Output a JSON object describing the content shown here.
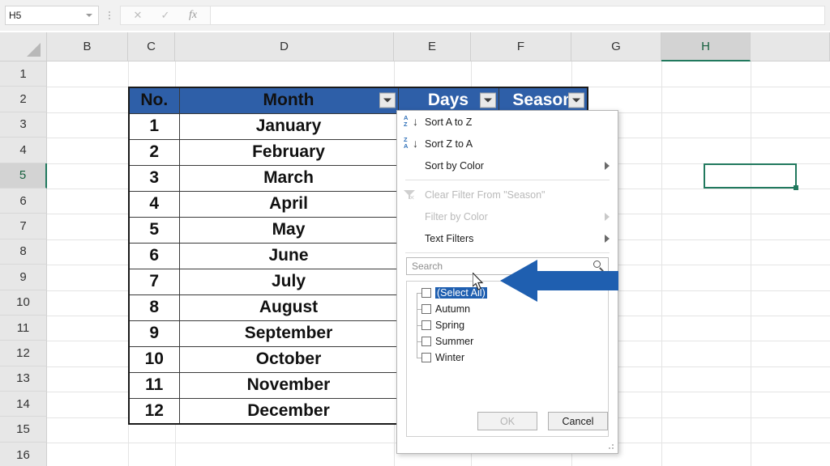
{
  "app": {
    "name_box_value": "H5",
    "formula_bar_value": "",
    "formula_icons": [
      "cancel-x",
      "enter-check",
      "insert-function-fx"
    ]
  },
  "grid": {
    "columns": [
      "B",
      "C",
      "D",
      "E",
      "F",
      "G",
      "H"
    ],
    "selected_column": "H",
    "rows": [
      "1",
      "2",
      "3",
      "4",
      "5",
      "6",
      "7",
      "8",
      "9",
      "10",
      "11",
      "12",
      "13",
      "14",
      "15",
      "16"
    ],
    "selected_row": "5",
    "selected_cell": "H5"
  },
  "table": {
    "headers": [
      "No.",
      "Month",
      "Days",
      "Season"
    ],
    "header_bg": "#2e5fa8",
    "header_color": "#ffffff",
    "rows": [
      {
        "no": "1",
        "month": "January",
        "days": "",
        "season": ""
      },
      {
        "no": "2",
        "month": "February",
        "days": "",
        "season": ""
      },
      {
        "no": "3",
        "month": "March",
        "days": "",
        "season": ""
      },
      {
        "no": "4",
        "month": "April",
        "days": "",
        "season": ""
      },
      {
        "no": "5",
        "month": "May",
        "days": "",
        "season": ""
      },
      {
        "no": "6",
        "month": "June",
        "days": "",
        "season": ""
      },
      {
        "no": "7",
        "month": "July",
        "days": "",
        "season": ""
      },
      {
        "no": "8",
        "month": "August",
        "days": "",
        "season": ""
      },
      {
        "no": "9",
        "month": "September",
        "days": "",
        "season": ""
      },
      {
        "no": "10",
        "month": "October",
        "days": "",
        "season": ""
      },
      {
        "no": "11",
        "month": "November",
        "days": "",
        "season": ""
      },
      {
        "no": "12",
        "month": "December",
        "days": "",
        "season": ""
      }
    ]
  },
  "filter_menu": {
    "sort_a_to_z": "Sort A to Z",
    "sort_z_to_a": "Sort Z to A",
    "sort_by_color": "Sort by Color",
    "clear_filter": "Clear Filter From \"Season\"",
    "filter_by_color": "Filter by Color",
    "text_filters": "Text Filters",
    "search_placeholder": "Search",
    "items": [
      {
        "label": "(Select All)",
        "checked": false,
        "highlighted": true
      },
      {
        "label": "Autumn",
        "checked": false,
        "highlighted": false
      },
      {
        "label": "Spring",
        "checked": false,
        "highlighted": false
      },
      {
        "label": "Summer",
        "checked": false,
        "highlighted": false
      },
      {
        "label": "Winter",
        "checked": false,
        "highlighted": false
      }
    ],
    "ok_label": "OK",
    "ok_enabled": false,
    "cancel_label": "Cancel"
  },
  "annotation": {
    "arrow_color": "#1f5fb0",
    "arrow_direction": "left",
    "points_at": "(Select All)"
  }
}
